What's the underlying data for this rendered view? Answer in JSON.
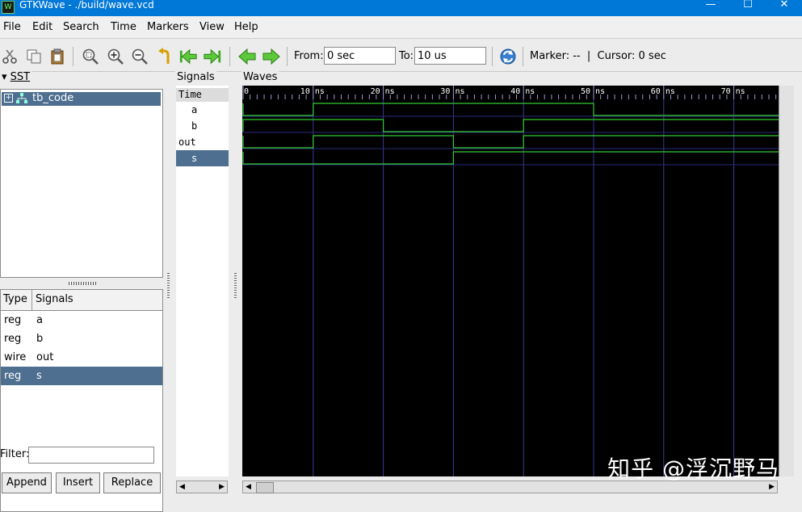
{
  "window": {
    "title": "GTKWave - ./build/wave.vcd",
    "app_icon_glyph": "W"
  },
  "menu": [
    "File",
    "Edit",
    "Search",
    "Time",
    "Markers",
    "View",
    "Help"
  ],
  "toolbar": {
    "icons": [
      "cut-icon",
      "copy-icon",
      "paste-icon",
      "zoom-fit-icon",
      "zoom-in-icon",
      "zoom-out-icon",
      "undo-zoom-icon",
      "goto-start-icon",
      "goto-end-icon",
      "prev-icon",
      "next-icon",
      "reload-icon"
    ],
    "from_label": "From:",
    "from_value": "0 sec",
    "to_label": "To:",
    "to_value": "10 us",
    "marker_cursor": "Marker: --  |  Cursor: 0 sec"
  },
  "sst": {
    "label": "SST",
    "tree_item": "tb_code",
    "columns": [
      "Type",
      "Signals"
    ],
    "rows": [
      {
        "type": "reg",
        "name": "a"
      },
      {
        "type": "reg",
        "name": "b"
      },
      {
        "type": "wire",
        "name": "out"
      },
      {
        "type": "reg",
        "name": "s"
      }
    ],
    "selected_index": 3,
    "filter_label": "Filter:",
    "filter_value": "",
    "buttons": {
      "append": "Append",
      "insert": "Insert",
      "replace": "Replace"
    }
  },
  "signals_panel": {
    "label": "Signals",
    "header": "Time",
    "rows": [
      "a",
      "b",
      "out",
      "s"
    ],
    "selected_index": 3
  },
  "waves": {
    "label": "Waves",
    "ticks": [
      "0",
      "10 ns",
      "20 ns",
      "30 ns",
      "40 ns",
      "50 ns",
      "60 ns",
      "70 ns"
    ],
    "tick_times_ns": [
      0,
      10,
      20,
      30,
      40,
      50,
      60,
      70
    ],
    "view_end_ns": 76.5,
    "signals": [
      {
        "name": "a",
        "transitions": [
          [
            0,
            0
          ],
          [
            10,
            1
          ],
          [
            50,
            0
          ]
        ]
      },
      {
        "name": "b",
        "transitions": [
          [
            0,
            1
          ],
          [
            20,
            0
          ],
          [
            40,
            1
          ]
        ]
      },
      {
        "name": "out",
        "transitions": [
          [
            0,
            0
          ],
          [
            10,
            1
          ],
          [
            30,
            0
          ],
          [
            40,
            1
          ]
        ]
      },
      {
        "name": "s",
        "transitions": [
          [
            0,
            0
          ],
          [
            30,
            1
          ]
        ]
      }
    ],
    "colors": {
      "background": "#000000",
      "wave": "#33cc33",
      "grid": "#3a3a9a",
      "text": "#ffffff",
      "separator": "#2a2a7a"
    }
  },
  "watermark": "知乎 @浮沉野马"
}
